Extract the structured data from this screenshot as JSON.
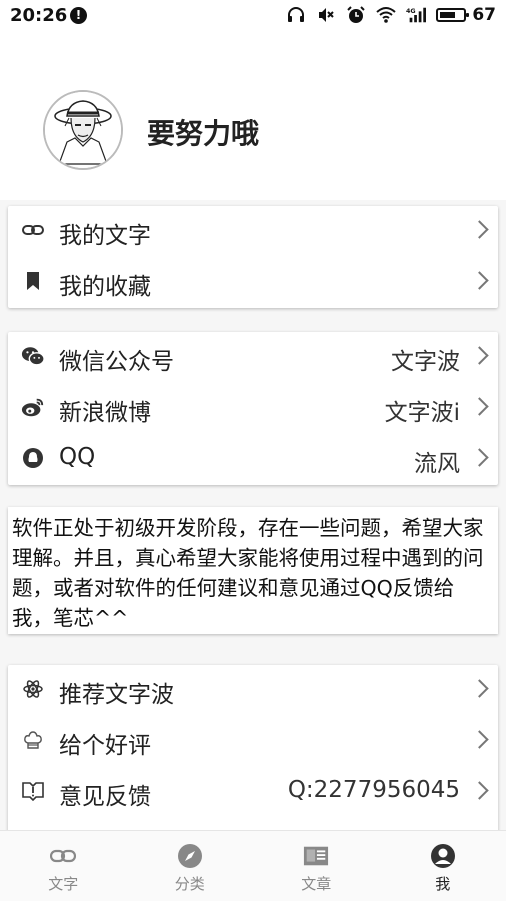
{
  "status_bar": {
    "time": "20:26",
    "battery": "67",
    "battery_level": 0.67,
    "network": "4G"
  },
  "profile": {
    "username": "要努力哦"
  },
  "group1": {
    "items": [
      {
        "label": "我的文字",
        "icon": "link-icon"
      },
      {
        "label": "我的收藏",
        "icon": "bookmark-icon"
      }
    ]
  },
  "group2": {
    "items": [
      {
        "label": "微信公众号",
        "value": "文字波",
        "icon": "wechat-icon"
      },
      {
        "label": "新浪微博",
        "value": "文字波i",
        "icon": "weibo-icon"
      },
      {
        "label": "QQ",
        "value": "流风",
        "icon": "qq-icon"
      }
    ]
  },
  "notice": {
    "text": "软件正处于初级开发阶段，存在一些问题，希望大家理解。并且，真心希望大家能将使用过程中遇到的问题，或者对软件的任何建议和意见通过QQ反馈给我，笔芯^^"
  },
  "group3": {
    "items": [
      {
        "label": "推荐文字波",
        "icon": "atom-icon"
      },
      {
        "label": "给个好评",
        "icon": "chef-hat-icon"
      },
      {
        "label": "意见反馈",
        "value": "Q:2277956045",
        "icon": "feedback-book-icon"
      }
    ]
  },
  "bottom_nav": {
    "items": [
      {
        "label": "文字",
        "icon": "link-icon"
      },
      {
        "label": "分类",
        "icon": "compass-icon"
      },
      {
        "label": "文章",
        "icon": "article-icon"
      },
      {
        "label": "我",
        "icon": "person-icon",
        "active": true
      }
    ]
  },
  "colors": {
    "background": "#f6f6f6",
    "card": "#ffffff",
    "text": "#222222",
    "nav_inactive": "#888888"
  }
}
